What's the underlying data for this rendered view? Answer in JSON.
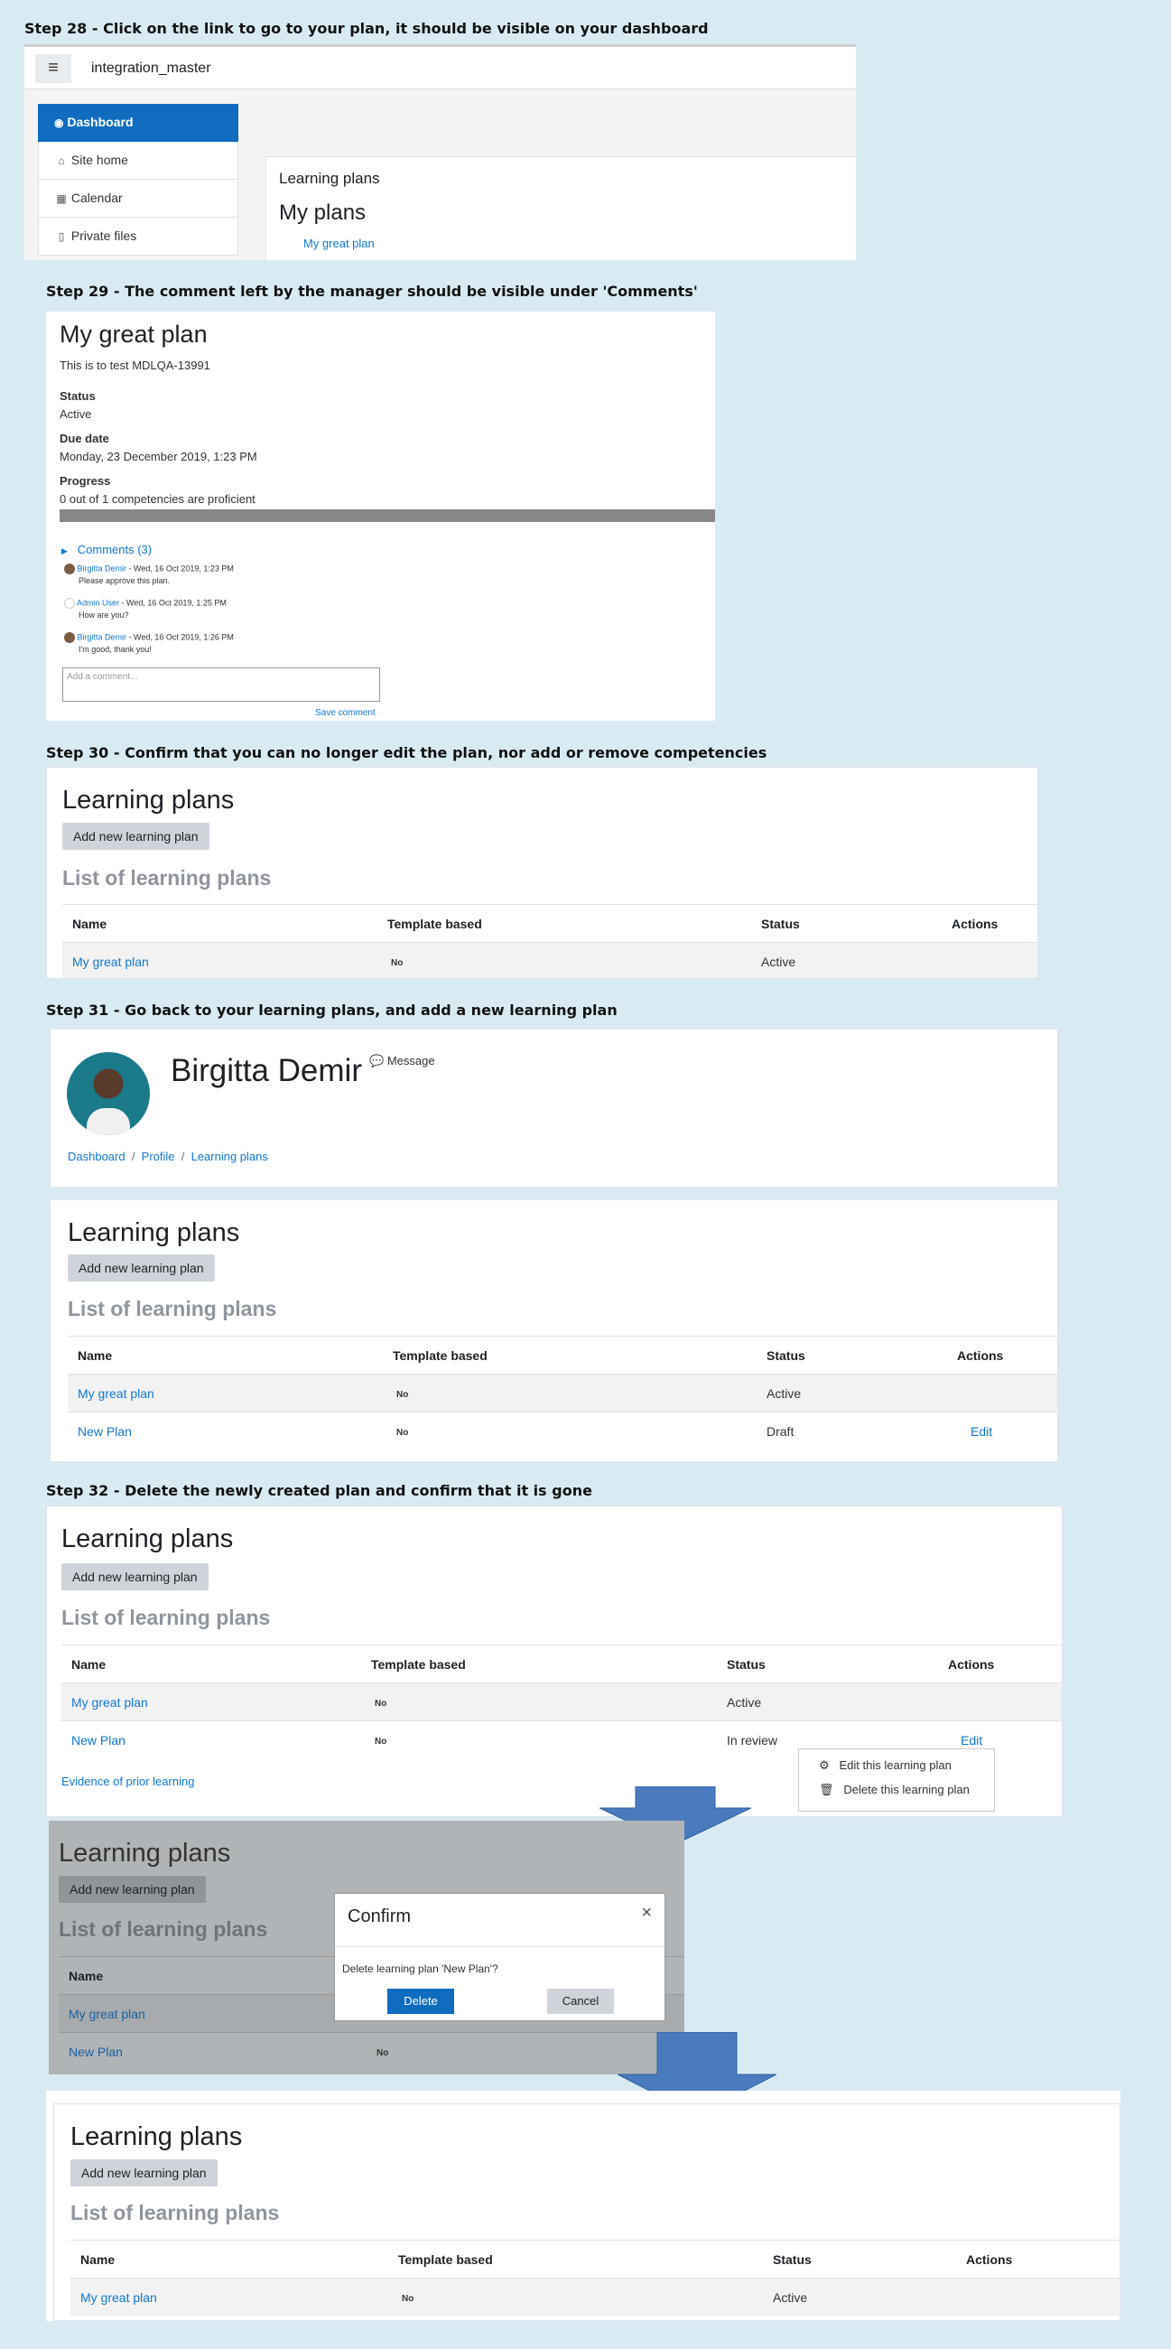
{
  "steps": {
    "s28": "Step 28 - Click on the link to go to your plan, it should be visible on your dashboard",
    "s29": "Step 29 - The comment left by the manager should be visible under 'Comments'",
    "s30": "Step 30 - Confirm that you can no longer edit the plan, nor add or remove competencies",
    "s31": "Step 31 - Go back to your learning plans, and add a new learning plan",
    "s32": "Step 32 - Delete the newly created plan and confirm that it is gone"
  },
  "dash": {
    "menu_icon": "≡",
    "site_name": "integration_master",
    "nav": [
      {
        "label": "Dashboard",
        "icon": "dashboard-icon"
      },
      {
        "label": "Site home",
        "icon": "home-icon"
      },
      {
        "label": "Calendar",
        "icon": "calendar-icon"
      },
      {
        "label": "Private files",
        "icon": "file-icon"
      }
    ],
    "block_title": "Learning plans",
    "my_plans": "My plans",
    "plan_link": "My great plan"
  },
  "plan": {
    "title": "My great plan",
    "description": "This is to test MDLQA-13991",
    "status_label": "Status",
    "status_value": "Active",
    "due_label": "Due date",
    "due_value": "Monday, 23 December 2019, 1:23 PM",
    "progress_label": "Progress",
    "progress_value": "0 out of 1 competencies are proficient",
    "progress_fraction": 0,
    "comments_toggle": "Comments (3)",
    "comments": [
      {
        "author": "Birgitta Demir",
        "date": " - Wed, 16 Oct 2019, 1:23 PM",
        "text": "Please approve this plan."
      },
      {
        "author": "Admin User",
        "date": " - Wed, 16 Oct 2019, 1:25 PM",
        "text": "How are you?"
      },
      {
        "author": "Birgitta Demir",
        "date": " - Wed, 16 Oct 2019, 1:26 PM",
        "text": "I'm good, thank you!"
      }
    ],
    "comment_placeholder": "Add a comment...",
    "save_comment": "Save comment"
  },
  "lp": {
    "heading": "Learning plans",
    "add_button": "Add new learning plan",
    "list_heading": "List of learning plans",
    "cols": {
      "name": "Name",
      "template": "Template based",
      "status": "Status",
      "actions": "Actions"
    },
    "plan1": {
      "name": "My great plan",
      "template": "No",
      "status": "Active"
    },
    "plan2": {
      "name": "New Plan",
      "template": "No",
      "status_draft": "Draft",
      "status_review": "In review"
    },
    "edit": "Edit"
  },
  "profile": {
    "name": "Birgitta Demir",
    "message": "Message",
    "breadcrumb": [
      "Dashboard",
      "Profile",
      "Learning plans"
    ]
  },
  "s32": {
    "evidence": "Evidence of prior learning",
    "menu": [
      "Edit this learning plan",
      "Delete this learning plan"
    ]
  },
  "confirm": {
    "title": "Confirm",
    "close": "×",
    "text": "Delete learning plan 'New Plan'?",
    "delete": "Delete",
    "cancel": "Cancel"
  },
  "colors": {
    "accent": "#1177d1",
    "nav_active": "#0f6cbf",
    "arrow": "#4a7bbf"
  }
}
